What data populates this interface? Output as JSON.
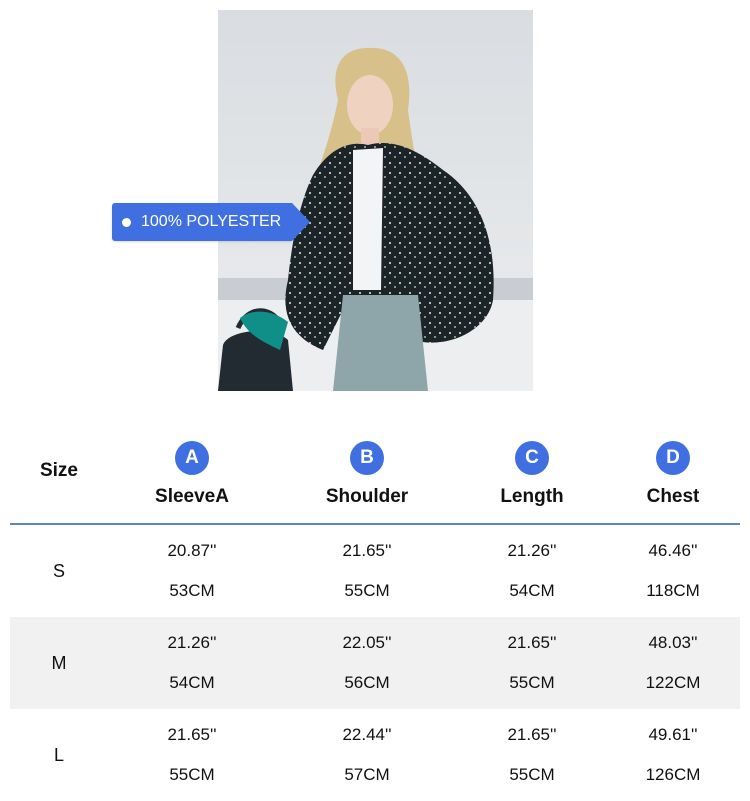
{
  "product": {
    "material_tag": "100% POLYESTER",
    "photo": "model-wearing-cropped-puffer-jacket"
  },
  "colors": {
    "accent": "#3f6fe0",
    "row_shade": "#f1f1f1",
    "divider": "#5b86c4"
  },
  "table": {
    "size_header": "Size",
    "columns": [
      {
        "letter": "A",
        "label": "SleeveA"
      },
      {
        "letter": "B",
        "label": "Shoulder"
      },
      {
        "letter": "C",
        "label": "Length"
      },
      {
        "letter": "D",
        "label": "Chest"
      }
    ],
    "rows": [
      {
        "size": "S",
        "values": [
          {
            "inch": "20.87''",
            "cm": "53CM"
          },
          {
            "inch": "21.65''",
            "cm": "55CM"
          },
          {
            "inch": "21.26''",
            "cm": "54CM"
          },
          {
            "inch": "46.46''",
            "cm": "118CM"
          }
        ]
      },
      {
        "size": "M",
        "values": [
          {
            "inch": "21.26''",
            "cm": "54CM"
          },
          {
            "inch": "22.05''",
            "cm": "56CM"
          },
          {
            "inch": "21.65''",
            "cm": "55CM"
          },
          {
            "inch": "48.03''",
            "cm": "122CM"
          }
        ]
      },
      {
        "size": "L",
        "values": [
          {
            "inch": "21.65''",
            "cm": "55CM"
          },
          {
            "inch": "22.44''",
            "cm": "57CM"
          },
          {
            "inch": "21.65''",
            "cm": "55CM"
          },
          {
            "inch": "49.61''",
            "cm": "126CM"
          }
        ]
      }
    ]
  }
}
